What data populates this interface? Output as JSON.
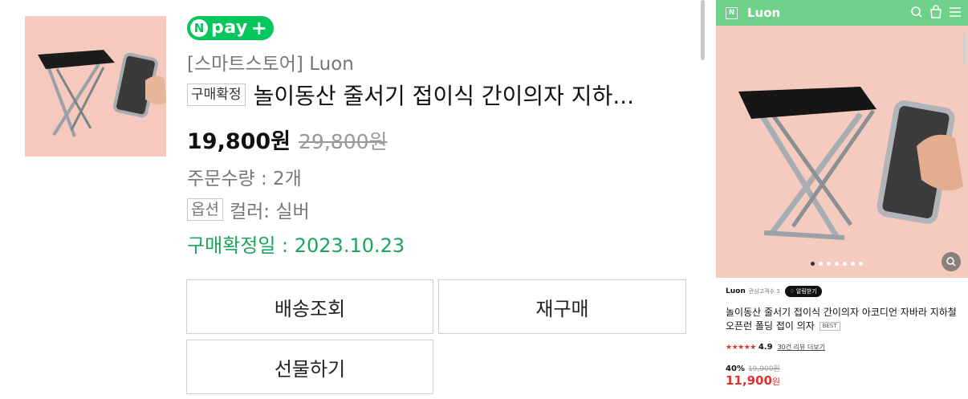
{
  "order": {
    "npay_text": "pay",
    "store": "[스마트스토어] Luon",
    "status_badge": "구매확정",
    "product_title": "놀이동산 줄서기 접이식 간이의자 지하...",
    "price": "19,800원",
    "original_price": "29,800원",
    "quantity": "주문수량 : 2개",
    "option_badge": "옵션",
    "option_value": "컬러: 실버",
    "confirm_date": "구매확정일 : 2023.10.23",
    "buttons": {
      "shipping": "배송조회",
      "rebuy": "재구매",
      "gift": "선물하기"
    }
  },
  "store_panel": {
    "logo_letter": "N",
    "store_name": "Luon",
    "seller_name": "Luon",
    "seller_fans": "관심고객수 3",
    "notify_button": "알림받기",
    "product_title": "놀이동산 줄서기 접이식 간이의자 아코디언 자바라 지하철 오픈런 폴딩 접이 의자",
    "best_tag": "BEST",
    "stars": "★★★★★",
    "rating": "4.9",
    "review_link": "30건 리뷰 더보기",
    "discount_rate": "40%",
    "original_price": "19,900원",
    "sale_price_number": "11,900",
    "sale_price_unit": "원",
    "image_count": 7,
    "active_image": 1
  },
  "colors": {
    "npay_green": "#03c75a",
    "confirm_green": "#19a55b",
    "store_header": "#6fd08a",
    "sale_red": "#e0322f",
    "product_bg": "#f5c9bd"
  }
}
